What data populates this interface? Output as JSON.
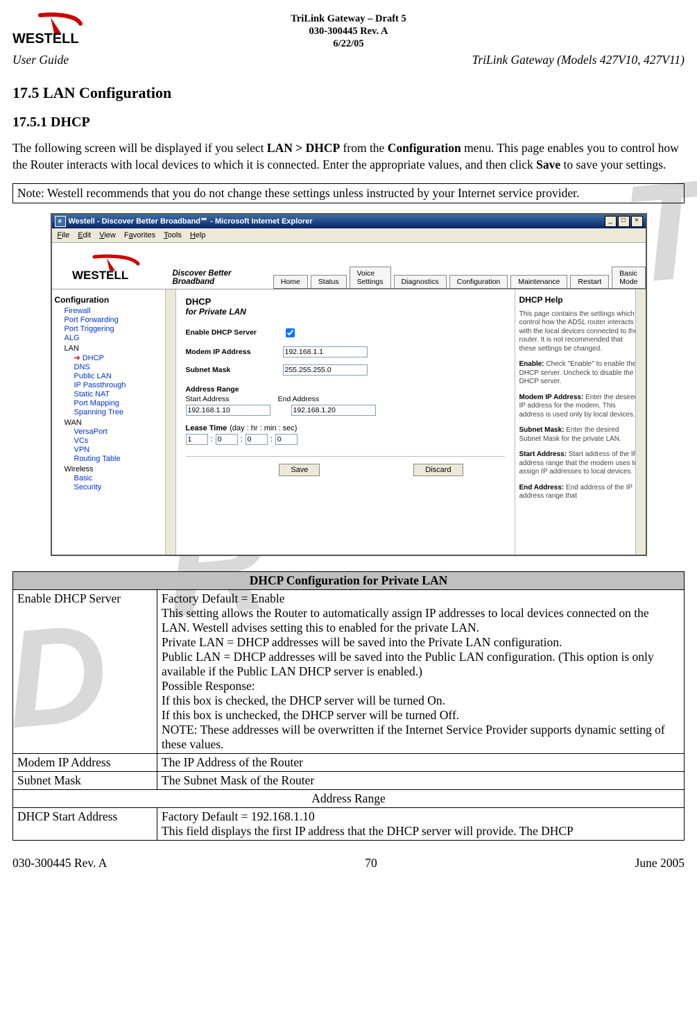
{
  "doc": {
    "header_l1": "TriLink Gateway – Draft 5",
    "header_l2": "030-300445 Rev. A",
    "header_l3": "6/22/05",
    "brand": "WESTELL",
    "userguide": "User Guide",
    "models": "TriLink Gateway (Models 427V10, 427V11)"
  },
  "sections": {
    "s1": "17.5 LAN Configuration",
    "s2": "17.5.1 DHCP"
  },
  "intro": {
    "pre": "The following screen will be displayed if you select ",
    "nav": "LAN > DHCP",
    "mid": " from the ",
    "menu": "Configuration",
    "post1": " menu. This page enables you to control how the Router interacts with local devices to which it is connected. Enter the appropriate values, and then click ",
    "save": "Save",
    "post2": " to save your settings."
  },
  "note": "Note: Westell recommends that you do not change these settings unless instructed by your Internet service provider.",
  "ie": {
    "title": "Westell - Discover Better Broadband℠ - Microsoft Internet Explorer",
    "menus": {
      "f": "File",
      "e": "Edit",
      "v": "View",
      "fa": "Favorites",
      "t": "Tools",
      "h": "Help"
    },
    "tagline": "Discover Better Broadband",
    "tabs": [
      "Home",
      "Status",
      "Voice Settings",
      "Diagnostics",
      "Configuration",
      "Maintenance",
      "Restart",
      "Basic Mode"
    ],
    "nav": {
      "config": "Configuration",
      "firewall": "Firewall",
      "pf": "Port Forwarding",
      "pt": "Port Triggering",
      "alg": "ALG",
      "lan": "LAN",
      "dhcp": "DHCP",
      "dns": "DNS",
      "publan": "Public LAN",
      "ipp": "IP Passthrough",
      "snat": "Static NAT",
      "pmap": "Port Mapping",
      "stree": "Spanning Tree",
      "wan": "WAN",
      "vp": "VersaPort",
      "vcs": "VCs",
      "vpn": "VPN",
      "rt": "Routing Table",
      "wireless": "Wireless",
      "basic": "Basic",
      "sec": "Security"
    },
    "form": {
      "heading": "DHCP",
      "sub": "for Private LAN",
      "enable_lbl": "Enable DHCP Server",
      "ip_lbl": "Modem IP Address",
      "ip_val": "192.168.1.1",
      "mask_lbl": "Subnet Mask",
      "mask_val": "255.255.255.0",
      "range_lbl": "Address Range",
      "start_lbl": "Start Address",
      "end_lbl": "End Address",
      "start_val": "192.168.1.10",
      "end_val": "192.168.1.20",
      "lease_lbl": "Lease Time",
      "lease_units": "(day : hr : min : sec)",
      "lease_d": "1",
      "lease_h": "0",
      "lease_m": "0",
      "lease_s": "0",
      "save": "Save",
      "discard": "Discard"
    },
    "help": {
      "title": "DHCP Help",
      "p1": "This page contains the settings which control how the ADSL router interacts with the local devices connected to the router. It is not recommended that these settings be changed.",
      "p2a": "Enable:",
      "p2b": " Check \"Enable\" to enable the DHCP server. Uncheck to disable the DHCP server.",
      "p3a": "Modem IP Address:",
      "p3b": " Enter the desired IP address for the modem. This address is used only by local devices.",
      "p4a": "Subnet Mask:",
      "p4b": " Enter the desired Subnet Mask for the private LAN.",
      "p5a": "Start Address:",
      "p5b": " Start address of the IP address range that the modem uses to assign IP addresses to local devices.",
      "p6a": "End Address:",
      "p6b": " End address of the IP address range that"
    }
  },
  "table": {
    "title": "DHCP Configuration for Private LAN",
    "rows": {
      "r1_label": "Enable DHCP Server",
      "r1_text": "Factory Default = Enable\nThis setting allows the Router to automatically assign IP addresses to local devices connected on the LAN. Westell advises setting this to enabled for the private LAN.\nPrivate LAN = DHCP addresses will be saved into the Private LAN configuration.\nPublic LAN = DHCP addresses will be saved into the Public LAN configuration. (This option is only available if the Public LAN DHCP server is enabled.)\nPossible Response:\nIf this box is checked, the DHCP server will be turned On.\nIf this box is unchecked, the DHCP server will be turned Off.\nNOTE: These addresses will be overwritten if the Internet Service Provider supports dynamic setting of these values.",
      "r2_label": "Modem IP Address",
      "r2_text": "The IP Address of the Router",
      "r3_label": "Subnet Mask",
      "r3_text": "The Subnet Mask of the Router",
      "sub": "Address Range",
      "r4_label": "DHCP Start Address",
      "r4_text": "Factory Default = 192.168.1.10\nThis field displays the first IP address that the DHCP server will provide. The DHCP"
    }
  },
  "footer": {
    "left": "030-300445 Rev. A",
    "center": "70",
    "right": "June 2005"
  }
}
